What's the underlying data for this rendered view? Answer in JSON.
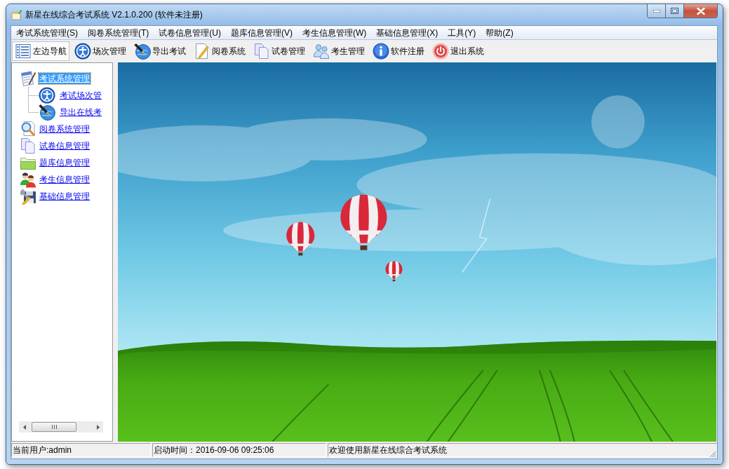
{
  "window": {
    "title": "新星在线综合考试系统 V2.1.0.200 (软件未注册)"
  },
  "menu": [
    "考试系统管理(S)",
    "阅卷系统管理(T)",
    "试卷信息管理(U)",
    "题库信息管理(V)",
    "考生信息管理(W)",
    "基础信息管理(X)",
    "工具(Y)",
    "帮助(Z)"
  ],
  "toolbar": [
    {
      "label": "左边导航",
      "checked": true
    },
    {
      "label": "场次管理",
      "checked": false
    },
    {
      "label": "导出考试",
      "checked": false
    },
    {
      "label": "阅卷系统",
      "checked": false
    },
    {
      "label": "试卷管理",
      "checked": false
    },
    {
      "label": "考生管理",
      "checked": false
    },
    {
      "label": "软件注册",
      "checked": false
    },
    {
      "label": "退出系统",
      "checked": false
    }
  ],
  "tree": [
    {
      "label": "考试系统管理",
      "selected": true,
      "children": [
        {
          "label": "考试场次管",
          "selected": false
        },
        {
          "label": "导出在线考",
          "selected": false
        }
      ]
    },
    {
      "label": "阅卷系统管理",
      "selected": false
    },
    {
      "label": "试卷信息管理",
      "selected": false
    },
    {
      "label": "题库信息管理",
      "selected": false
    },
    {
      "label": "考生信息管理",
      "selected": false
    },
    {
      "label": "基础信息管理",
      "selected": false
    }
  ],
  "status_bar": [
    "当前用户:admin",
    "启动时间：2016-09-06 09:25:06",
    "欢迎使用新星在线综合考试系统"
  ]
}
